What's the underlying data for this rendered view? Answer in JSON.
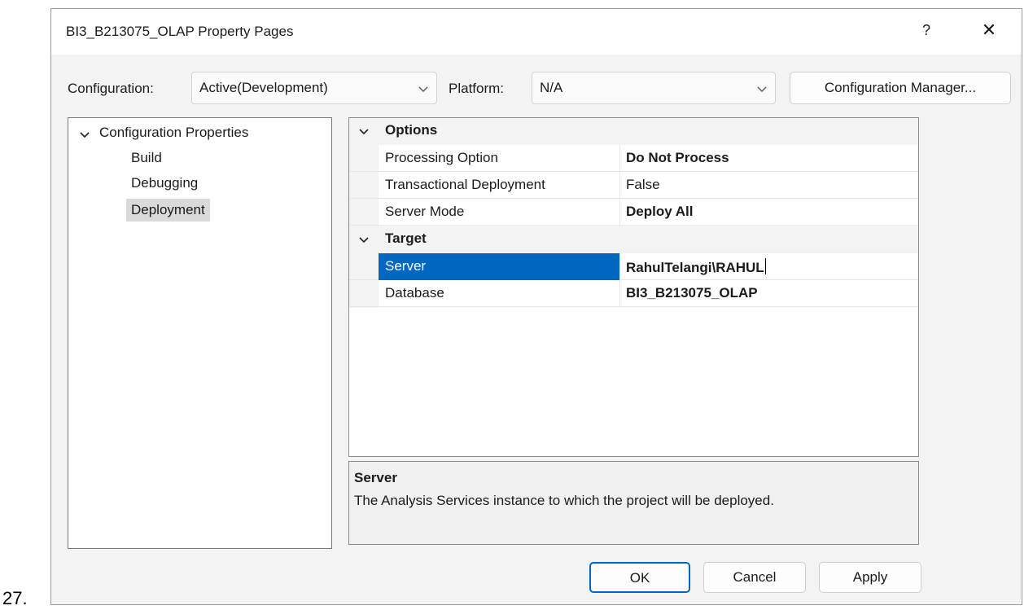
{
  "outer": {
    "list_number": "27."
  },
  "window": {
    "title": "BI3_B213075_OLAP Property Pages",
    "help_label": "?",
    "close_label": "✕"
  },
  "toolbar": {
    "configuration_label": "Configuration:",
    "configuration_value": "Active(Development)",
    "platform_label": "Platform:",
    "platform_value": "N/A",
    "config_manager_label": "Configuration Manager..."
  },
  "tree": {
    "root": "Configuration Properties",
    "items": [
      "Build",
      "Debugging",
      "Deployment"
    ],
    "selected": "Deployment"
  },
  "grid": {
    "categories": [
      {
        "title": "Options",
        "rows": [
          {
            "name": "Processing Option",
            "value": "Do Not Process",
            "bold": true
          },
          {
            "name": "Transactional Deployment",
            "value": "False",
            "bold": false
          },
          {
            "name": "Server Mode",
            "value": "Deploy All",
            "bold": true
          }
        ]
      },
      {
        "title": "Target",
        "rows": [
          {
            "name": "Server",
            "value": "RahulTelangi\\RAHUL",
            "bold": true,
            "selected": true
          },
          {
            "name": "Database",
            "value": "BI3_B213075_OLAP",
            "bold": true
          }
        ]
      }
    ]
  },
  "description": {
    "title": "Server",
    "text": "The Analysis Services instance to which the project will be deployed."
  },
  "buttons": {
    "ok": "OK",
    "cancel": "Cancel",
    "apply": "Apply"
  },
  "colors": {
    "selection": "#0067c0",
    "accent_border": "#0067c0"
  }
}
